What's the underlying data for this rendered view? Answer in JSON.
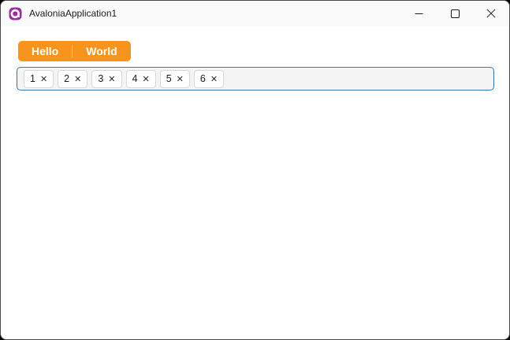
{
  "titlebar": {
    "title": "AvaloniaApplication1",
    "app_icon": "avalonia-logo"
  },
  "window_controls": {
    "minimize": "minimize",
    "maximize": "maximize",
    "close": "close"
  },
  "tab_strip": {
    "tabs": [
      {
        "label": "Hello"
      },
      {
        "label": "World"
      }
    ]
  },
  "chip_input": {
    "chips": [
      {
        "label": "1"
      },
      {
        "label": "2"
      },
      {
        "label": "3"
      },
      {
        "label": "4"
      },
      {
        "label": "5"
      },
      {
        "label": "6"
      }
    ],
    "remove_glyph": "✕"
  },
  "colors": {
    "accent-orange": "#F7941E",
    "focus-border": "#3177A8",
    "titlebar-bg": "#FAFAFA",
    "content-bg": "#FFFFFF",
    "chipbar-bg": "#F4F4F4",
    "chip-bg": "#FFFFFF",
    "chip-border": "#D8D8D8",
    "logo-purple": "#9A2E9E",
    "text-dark": "#1B1B1B"
  }
}
